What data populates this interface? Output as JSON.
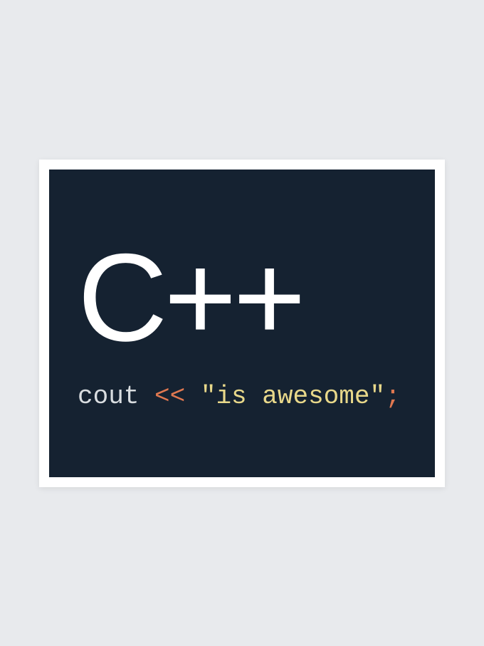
{
  "poster": {
    "title": "C++",
    "code": {
      "cout": "cout ",
      "operator": "<< ",
      "string": "\"is awesome\"",
      "semicolon": ";"
    },
    "colors": {
      "background": "#e8eaed",
      "panel": "#152231",
      "titleText": "#ffffff",
      "coutText": "#d9dde0",
      "operatorText": "#e07850",
      "stringText": "#e8d88a",
      "semiText": "#e07850"
    }
  }
}
